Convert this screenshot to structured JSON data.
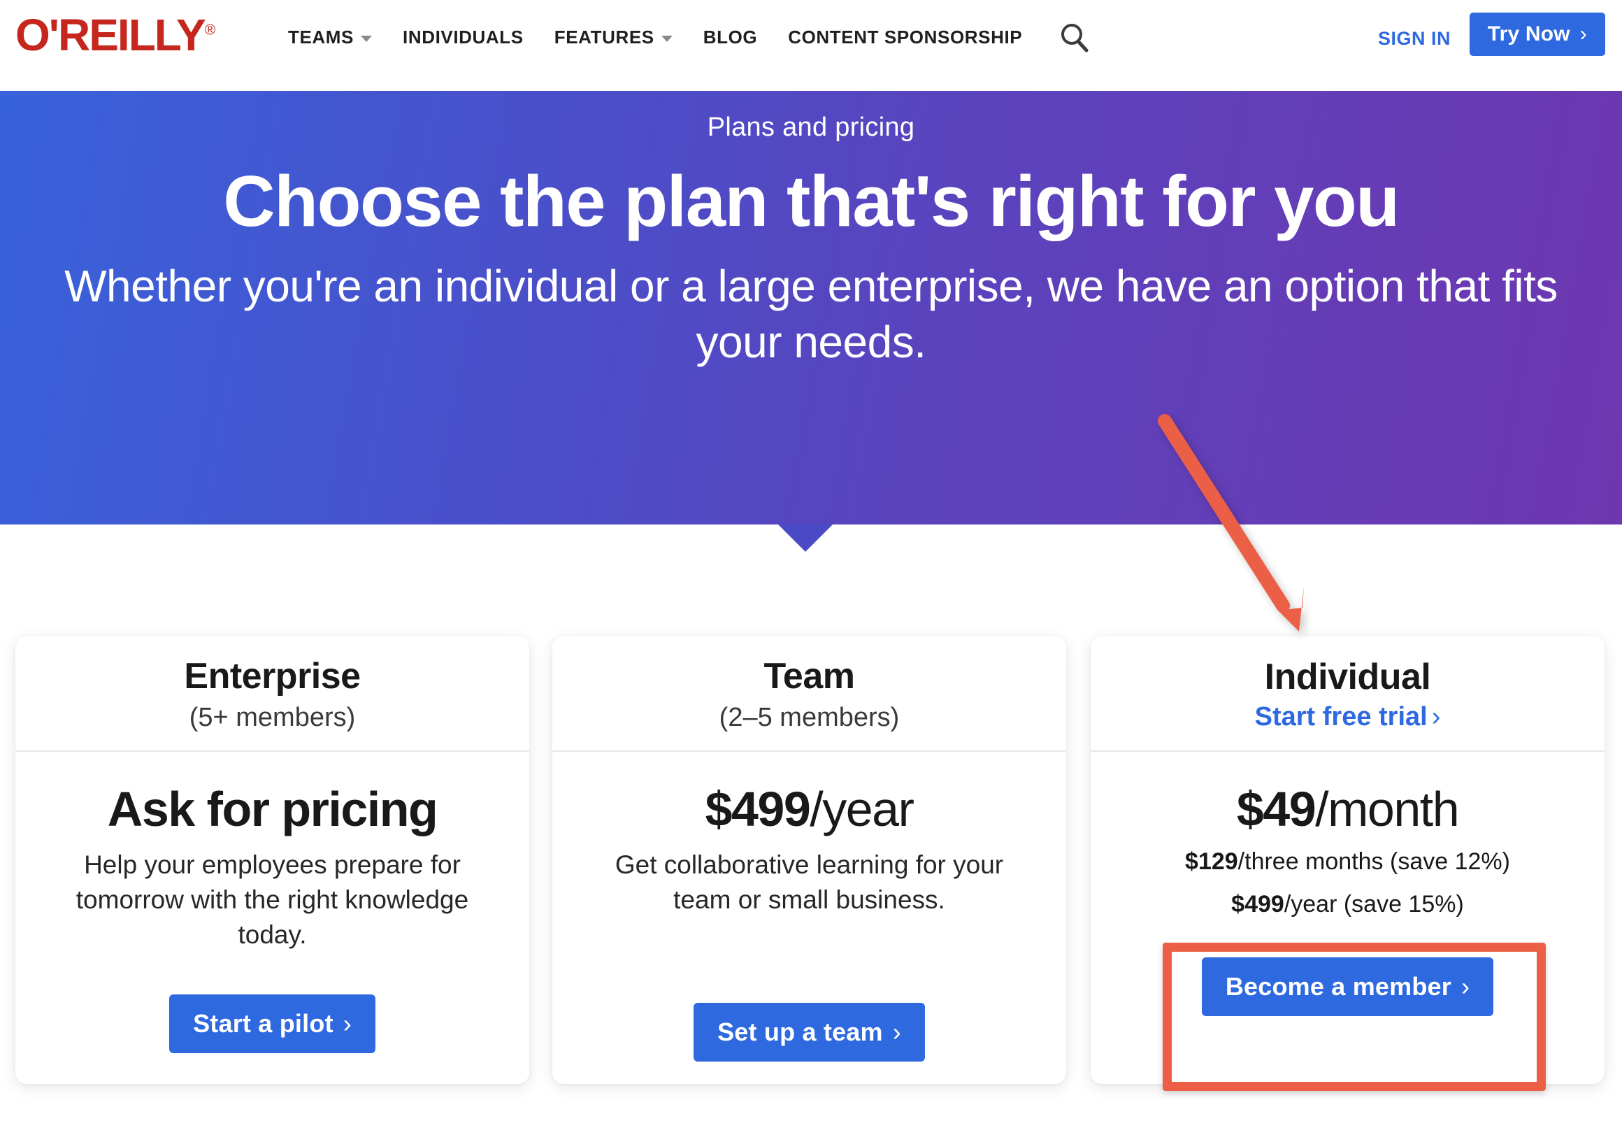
{
  "header": {
    "logo_text": "O'REILLY",
    "logo_registered": "®",
    "logo_color": "#c5271e",
    "nav": [
      {
        "label": "TEAMS",
        "has_dropdown": true
      },
      {
        "label": "INDIVIDUALS",
        "has_dropdown": false
      },
      {
        "label": "FEATURES",
        "has_dropdown": true
      },
      {
        "label": "BLOG",
        "has_dropdown": false
      },
      {
        "label": "CONTENT SPONSORSHIP",
        "has_dropdown": false
      }
    ],
    "search_icon": "search-icon",
    "sign_in": "SIGN IN",
    "try_now": "Try Now",
    "try_now_chevron": "›",
    "accent_color": "#2e69e0"
  },
  "hero": {
    "eyebrow": "Plans and pricing",
    "title": "Choose the plan that's right for you",
    "subtitle": "Whether you're an individual or a large enterprise, we have an option that fits your needs.",
    "gradient_start": "#3862db",
    "gradient_end": "#6e37b0",
    "notch_color": "#4a4ac4"
  },
  "plans": [
    {
      "name": "Enterprise",
      "members": "(5+ members)",
      "price_amount": "Ask for pricing",
      "price_period": "",
      "description": "Help your employees prepare for tomorrow with the right knowledge today.",
      "alt_prices": [],
      "cta_label": "Start a pilot",
      "cta_chevron": "›",
      "link_label": ""
    },
    {
      "name": "Team",
      "members": "(2–5 members)",
      "price_amount": "$499",
      "price_period": "/year",
      "description": "Get collaborative learning for your team or small business.",
      "alt_prices": [],
      "cta_label": "Set up a team",
      "cta_chevron": "›",
      "link_label": ""
    },
    {
      "name": "Individual",
      "members": "",
      "link_label": "Start free trial",
      "link_chevron": "›",
      "price_amount": "$49",
      "price_period": "/month",
      "alt_prices": [
        {
          "amount": "$129",
          "period": "/three months (save 12%)"
        },
        {
          "amount": "$499",
          "period": "/year (save 15%)"
        }
      ],
      "description": "",
      "cta_label": "Become a member",
      "cta_chevron": "›"
    }
  ],
  "annotations": {
    "arrow_color": "#ec5e46",
    "highlight_box_color": "#ec5e46",
    "highlight_target": "Become a member"
  }
}
